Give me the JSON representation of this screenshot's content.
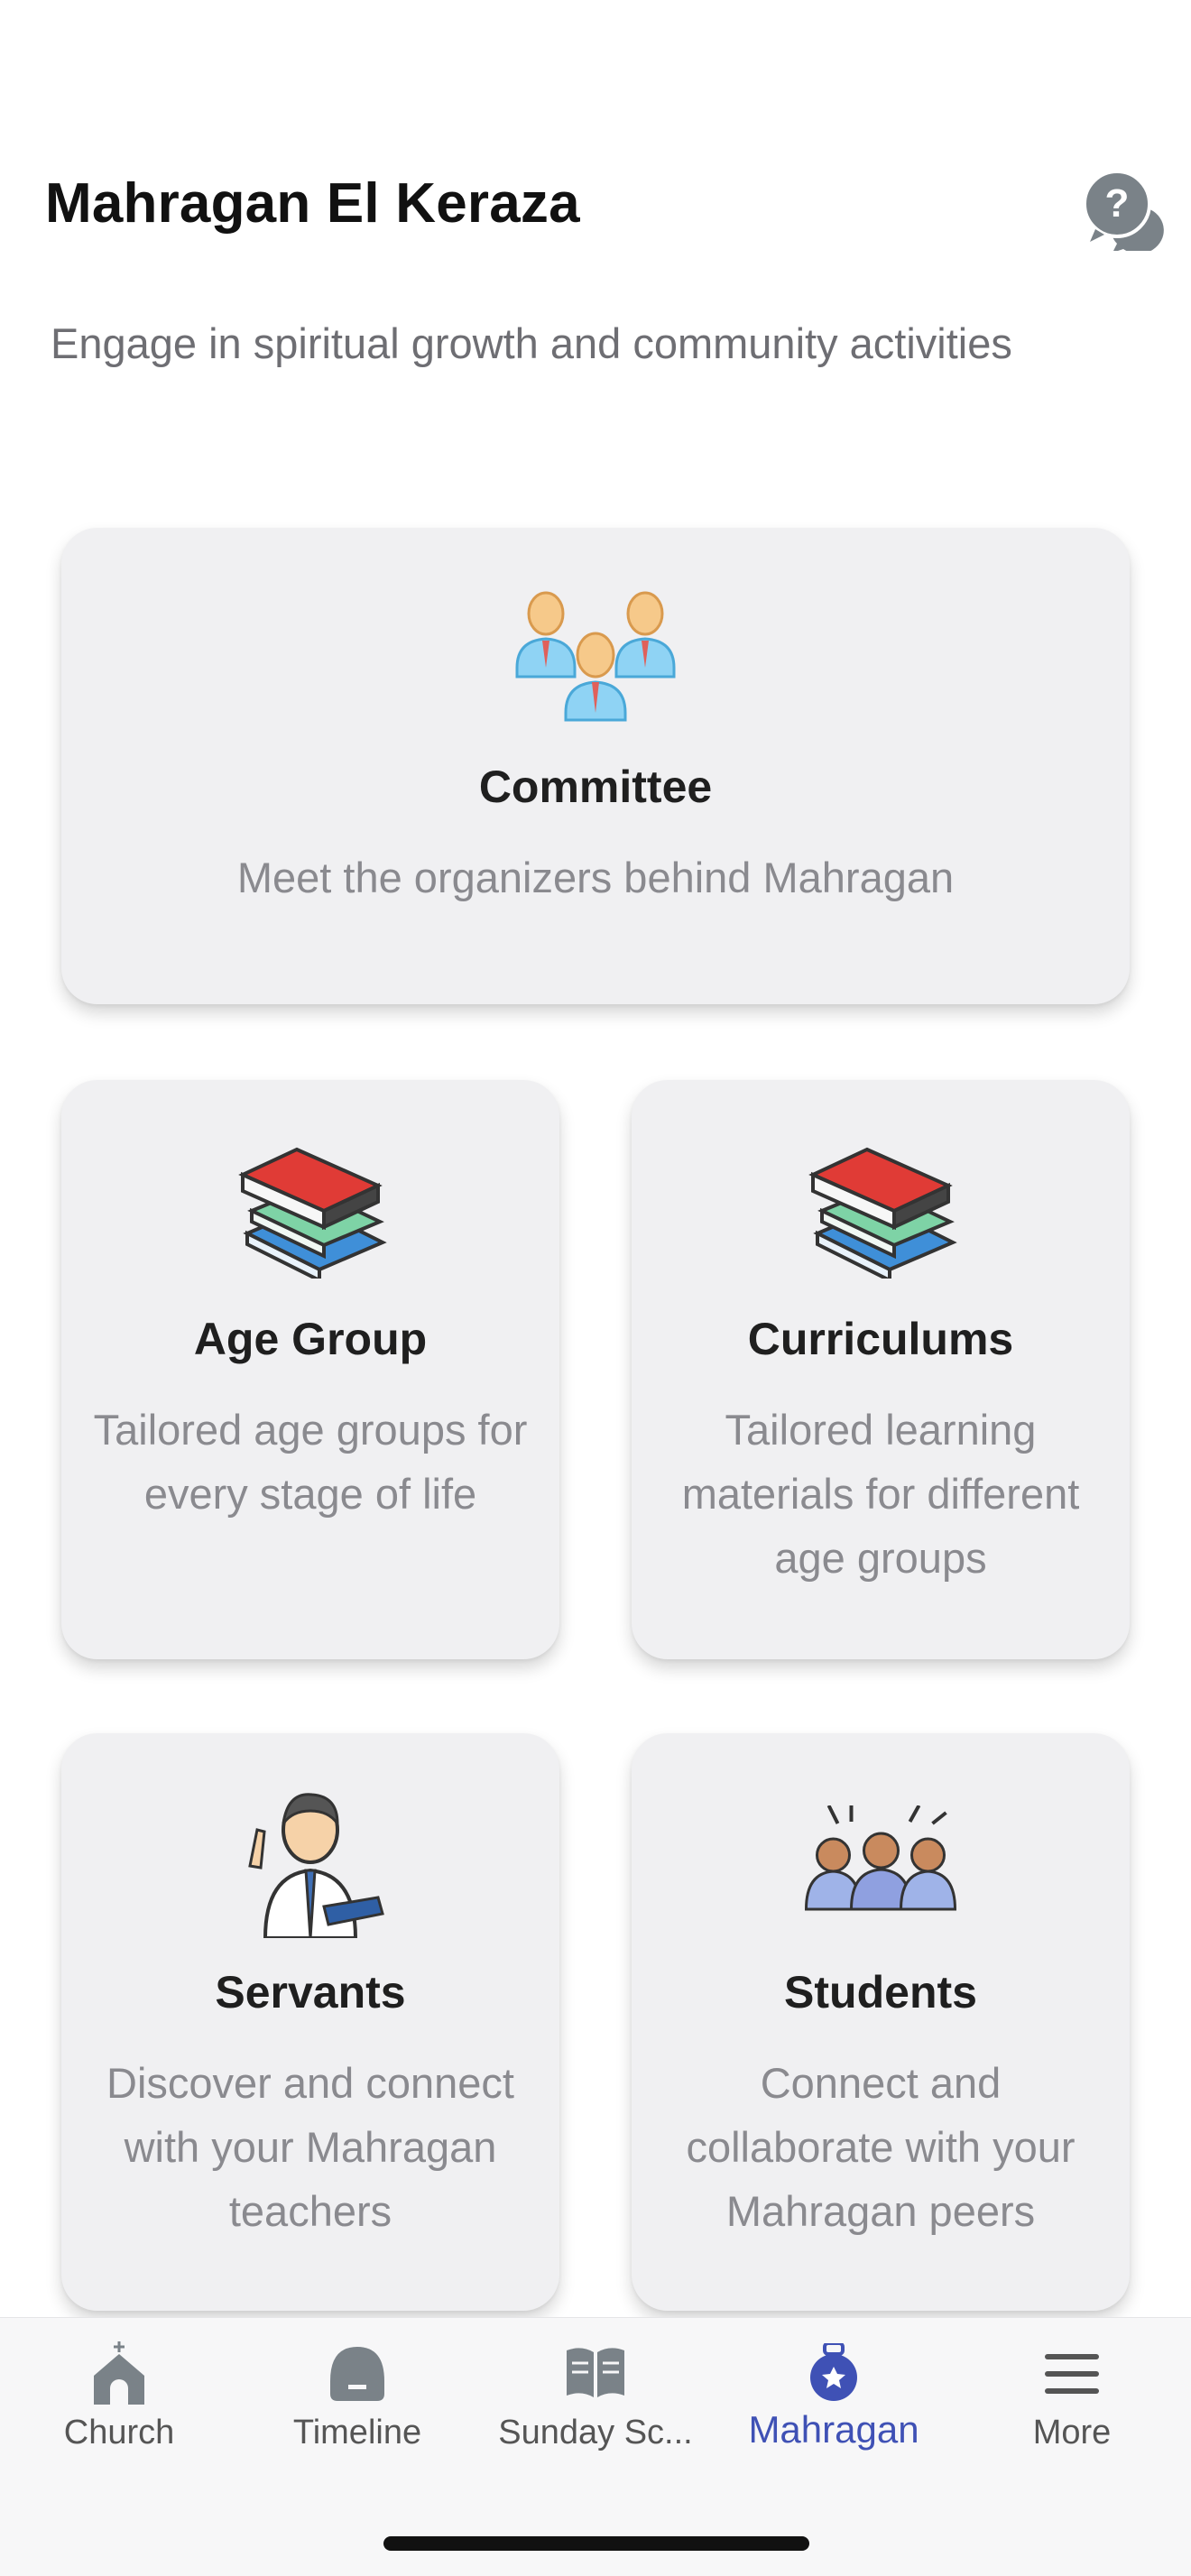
{
  "header": {
    "title": "Mahragan El Keraza",
    "subtitle": "Engage in spiritual growth and community activities"
  },
  "icons": {
    "help": "help-chat-icon"
  },
  "cards": {
    "committee": {
      "title": "Committee",
      "description": "Meet the organizers behind Mahragan",
      "icon": "committee-people-icon"
    },
    "age_group": {
      "title": "Age Group",
      "description": "Tailored age groups for every stage of life",
      "icon": "books-stack-icon"
    },
    "curriculums": {
      "title": "Curriculums",
      "description": "Tailored learning materials for different age groups",
      "icon": "books-stack-icon"
    },
    "servants": {
      "title": "Servants",
      "description": "Discover and connect with your Mahragan teachers",
      "icon": "teacher-icon"
    },
    "students": {
      "title": "Students",
      "description": "Connect and collaborate with your Mahragan peers",
      "icon": "students-icon"
    }
  },
  "tabbar": {
    "tabs": [
      {
        "label": "Church",
        "icon": "church-icon"
      },
      {
        "label": "Timeline",
        "icon": "timeline-icon"
      },
      {
        "label": "Sunday Sc...",
        "icon": "open-book-icon"
      },
      {
        "label": "Mahragan",
        "icon": "mahragan-icon",
        "active": true
      },
      {
        "label": "More",
        "icon": "menu-icon"
      }
    ]
  },
  "colors": {
    "accent": "#3f51b5",
    "card_bg": "#f0f0f2",
    "muted_text": "#8a8a8f"
  }
}
